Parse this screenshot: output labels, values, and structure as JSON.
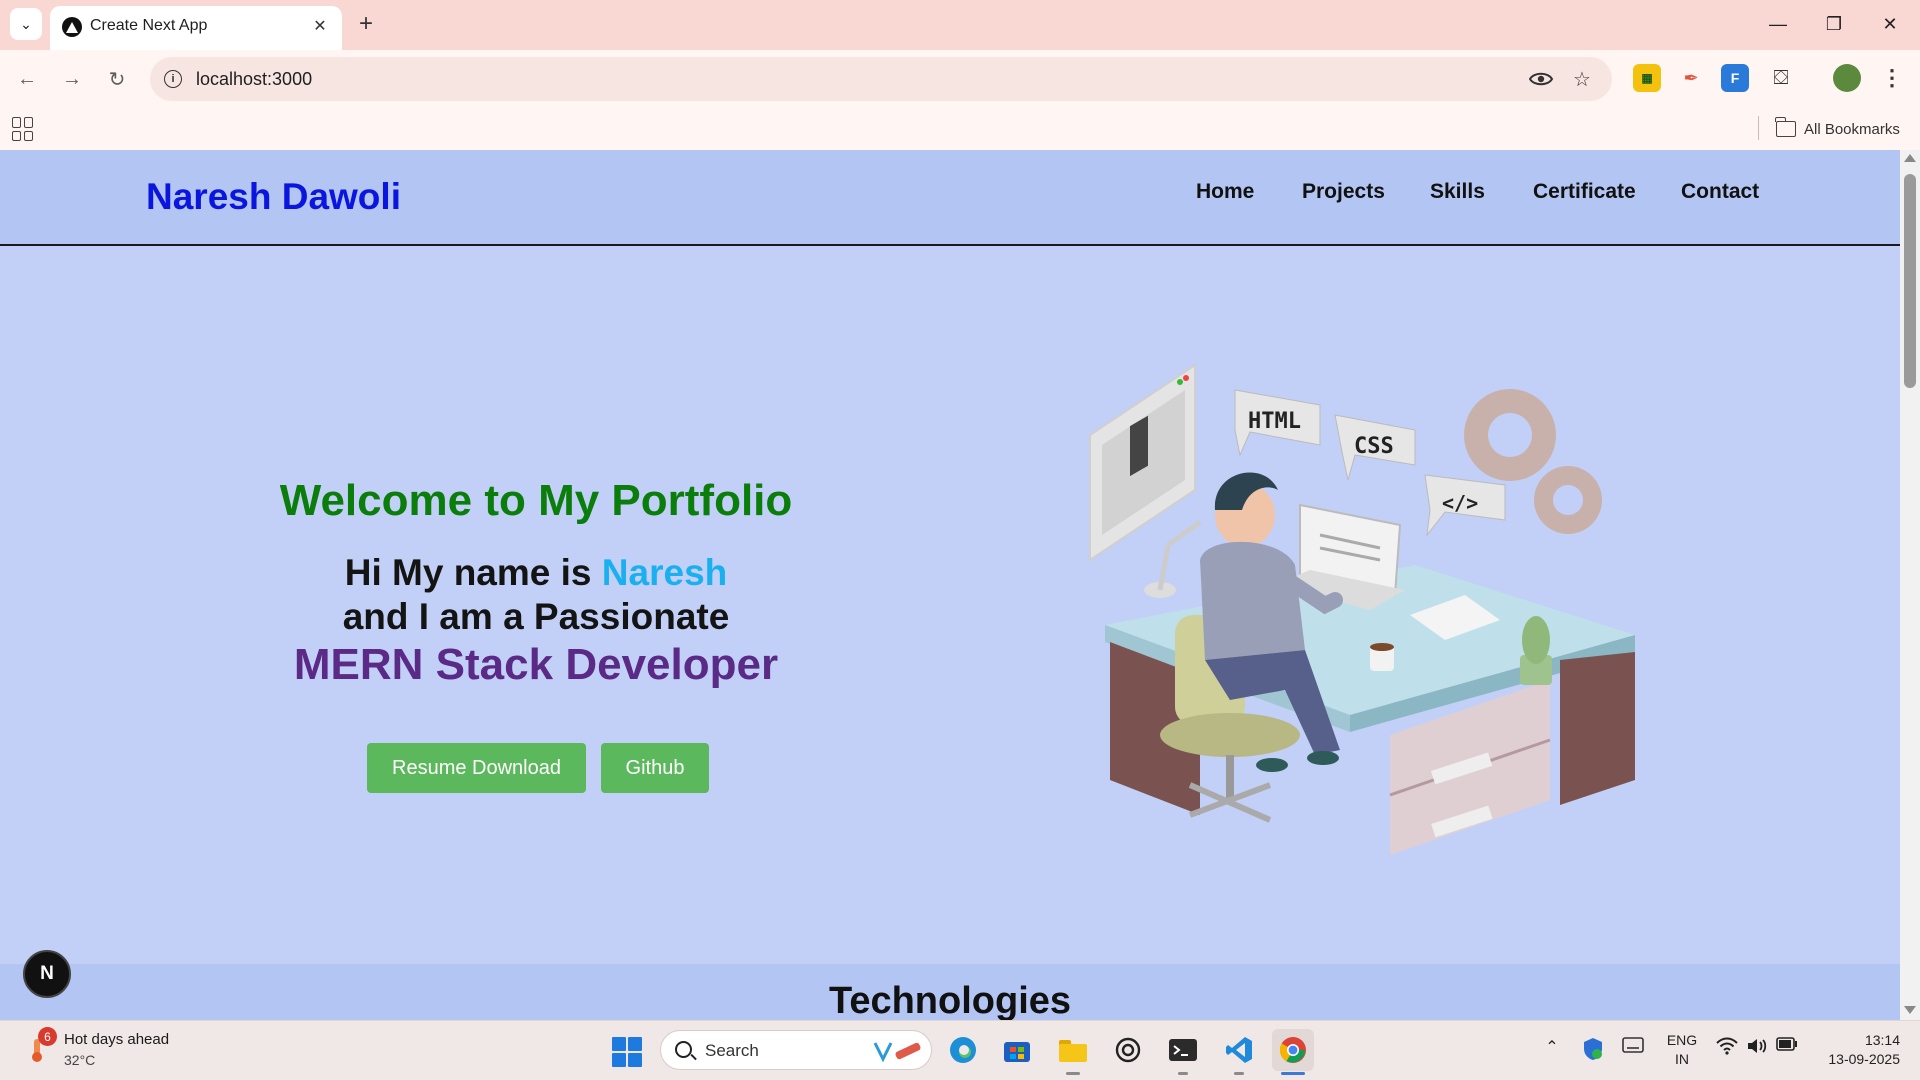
{
  "browser": {
    "tab_title": "Create Next App",
    "url": "localhost:3000",
    "bookmarks_label": "All Bookmarks"
  },
  "site": {
    "logo": "Naresh Dawoli",
    "nav": [
      "Home",
      "Projects",
      "Skills",
      "Certificate",
      "Contact"
    ],
    "hero": {
      "title": "Welcome to My Portfolio",
      "line1_prefix": "Hi My name is",
      "line1_name": "Naresh",
      "line2": "and I am a Passionate",
      "line3": "MERN Stack Developer",
      "btn_resume": "Resume Download",
      "btn_github": "Github"
    },
    "illustration_labels": {
      "html": "HTML",
      "css": "CSS",
      "code": "</>"
    },
    "section_title": "Technologies",
    "dev_badge": "N"
  },
  "taskbar": {
    "weather_badge": "6",
    "weather_title": "Hot days ahead",
    "weather_temp": "32°C",
    "search_placeholder": "Search",
    "lang_line1": "ENG",
    "lang_line2": "IN",
    "time": "13:14",
    "date": "13-09-2025"
  },
  "colors": {
    "page_bg": "#c2d0f7",
    "header_bg": "#b3c5f2",
    "logo": "#0a16e0",
    "welcome": "#0a7d0a",
    "name_accent": "#1ab0f0",
    "mern": "#5a2a86",
    "button": "#5cb85c",
    "tab_strip": "#f9d7d3"
  }
}
